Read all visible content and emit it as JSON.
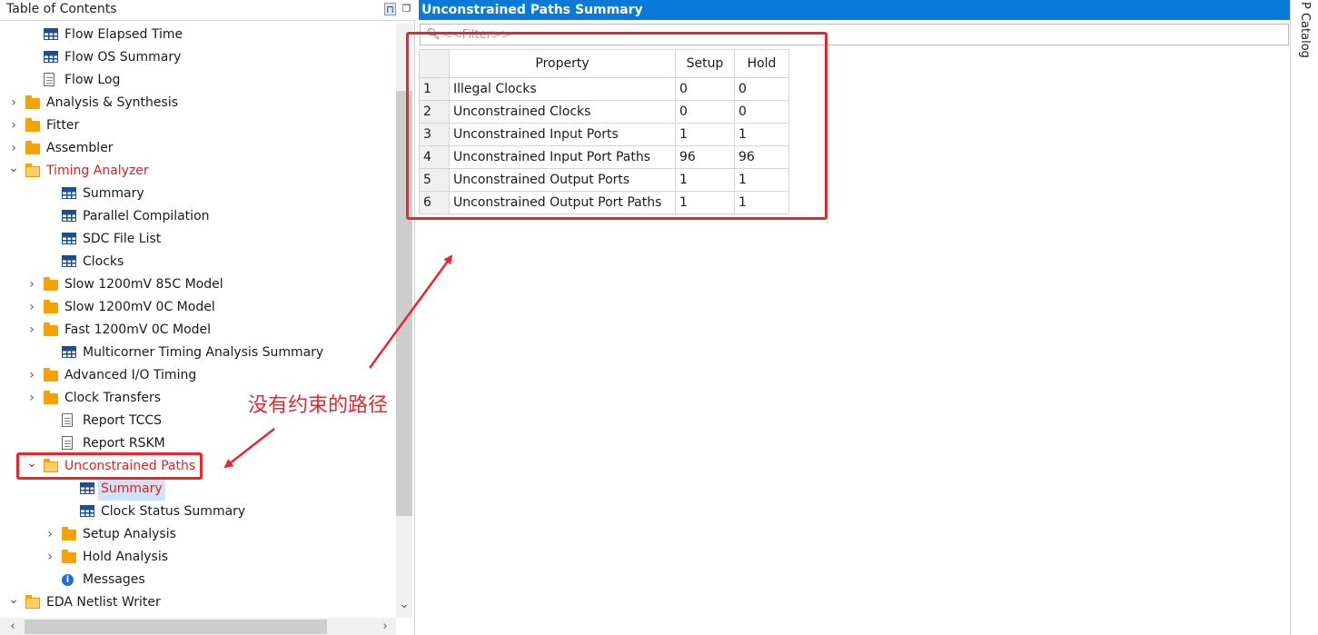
{
  "toc": {
    "title": "Table of Contents",
    "pin_glyph": "⊓",
    "float_glyph": "❐",
    "items": [
      {
        "label": "Flow Elapsed Time",
        "icon": "table-icon",
        "depth": 1
      },
      {
        "label": "Flow OS Summary",
        "icon": "table-icon",
        "depth": 1
      },
      {
        "label": "Flow Log",
        "icon": "document-icon",
        "depth": 1
      },
      {
        "label": "Analysis & Synthesis",
        "icon": "folder-icon",
        "depth": 0,
        "expand": "collapsed"
      },
      {
        "label": "Fitter",
        "icon": "folder-icon",
        "depth": 0,
        "expand": "collapsed"
      },
      {
        "label": "Assembler",
        "icon": "folder-icon",
        "depth": 0,
        "expand": "collapsed"
      },
      {
        "label": "Timing Analyzer",
        "icon": "folder-open-icon",
        "depth": 0,
        "expand": "expanded",
        "highlight": true
      },
      {
        "label": "Summary",
        "icon": "table-icon",
        "depth": 2
      },
      {
        "label": "Parallel Compilation",
        "icon": "table-icon",
        "depth": 2
      },
      {
        "label": "SDC File List",
        "icon": "table-icon",
        "depth": 2
      },
      {
        "label": "Clocks",
        "icon": "table-icon",
        "depth": 2
      },
      {
        "label": "Slow 1200mV 85C Model",
        "icon": "folder-icon",
        "depth": 1,
        "expand": "collapsed"
      },
      {
        "label": "Slow 1200mV 0C Model",
        "icon": "folder-icon",
        "depth": 1,
        "expand": "collapsed"
      },
      {
        "label": "Fast 1200mV 0C Model",
        "icon": "folder-icon",
        "depth": 1,
        "expand": "collapsed"
      },
      {
        "label": "Multicorner Timing Analysis Summary",
        "icon": "table-icon",
        "depth": 2
      },
      {
        "label": "Advanced I/O Timing",
        "icon": "folder-icon",
        "depth": 1,
        "expand": "collapsed"
      },
      {
        "label": "Clock Transfers",
        "icon": "folder-icon",
        "depth": 1,
        "expand": "collapsed"
      },
      {
        "label": "Report TCCS",
        "icon": "document-icon",
        "depth": 2
      },
      {
        "label": "Report RSKM",
        "icon": "document-icon",
        "depth": 2
      },
      {
        "label": "Unconstrained Paths",
        "icon": "folder-open-icon",
        "depth": 1,
        "expand": "expanded",
        "highlight": true
      },
      {
        "label": "Summary",
        "icon": "table-icon",
        "depth": 3,
        "selected": true,
        "highlight": true
      },
      {
        "label": "Clock Status Summary",
        "icon": "table-icon",
        "depth": 3
      },
      {
        "label": "Setup Analysis",
        "icon": "folder-icon",
        "depth": 2,
        "expand": "collapsed"
      },
      {
        "label": "Hold Analysis",
        "icon": "folder-icon",
        "depth": 2,
        "expand": "collapsed"
      },
      {
        "label": "Messages",
        "icon": "info-icon",
        "depth": 2
      },
      {
        "label": "EDA Netlist Writer",
        "icon": "folder-open-icon",
        "depth": 0,
        "expand": "expanded"
      }
    ]
  },
  "content": {
    "title": "Unconstrained Paths Summary",
    "filter_placeholder": "<<Filter>>",
    "table": {
      "headers": [
        "Property",
        "Setup",
        "Hold"
      ],
      "rows": [
        {
          "num": "1",
          "property": "Illegal Clocks",
          "setup": "0",
          "hold": "0"
        },
        {
          "num": "2",
          "property": "Unconstrained Clocks",
          "setup": "0",
          "hold": "0"
        },
        {
          "num": "3",
          "property": "Unconstrained Input Ports",
          "setup": "1",
          "hold": "1"
        },
        {
          "num": "4",
          "property": "Unconstrained Input Port Paths",
          "setup": "96",
          "hold": "96"
        },
        {
          "num": "5",
          "property": "Unconstrained Output Ports",
          "setup": "1",
          "hold": "1"
        },
        {
          "num": "6",
          "property": "Unconstrained Output Port Paths",
          "setup": "1",
          "hold": "1"
        }
      ]
    }
  },
  "side_tab": {
    "label": "P Catalog"
  },
  "annotation": {
    "text": "没有约束的路径",
    "color": "#e8262b"
  },
  "colors": {
    "title_bar": "#0a7ad8",
    "folder": "#f4a200",
    "highlight_text": "#e02020",
    "selection": "#cfe3f7"
  }
}
